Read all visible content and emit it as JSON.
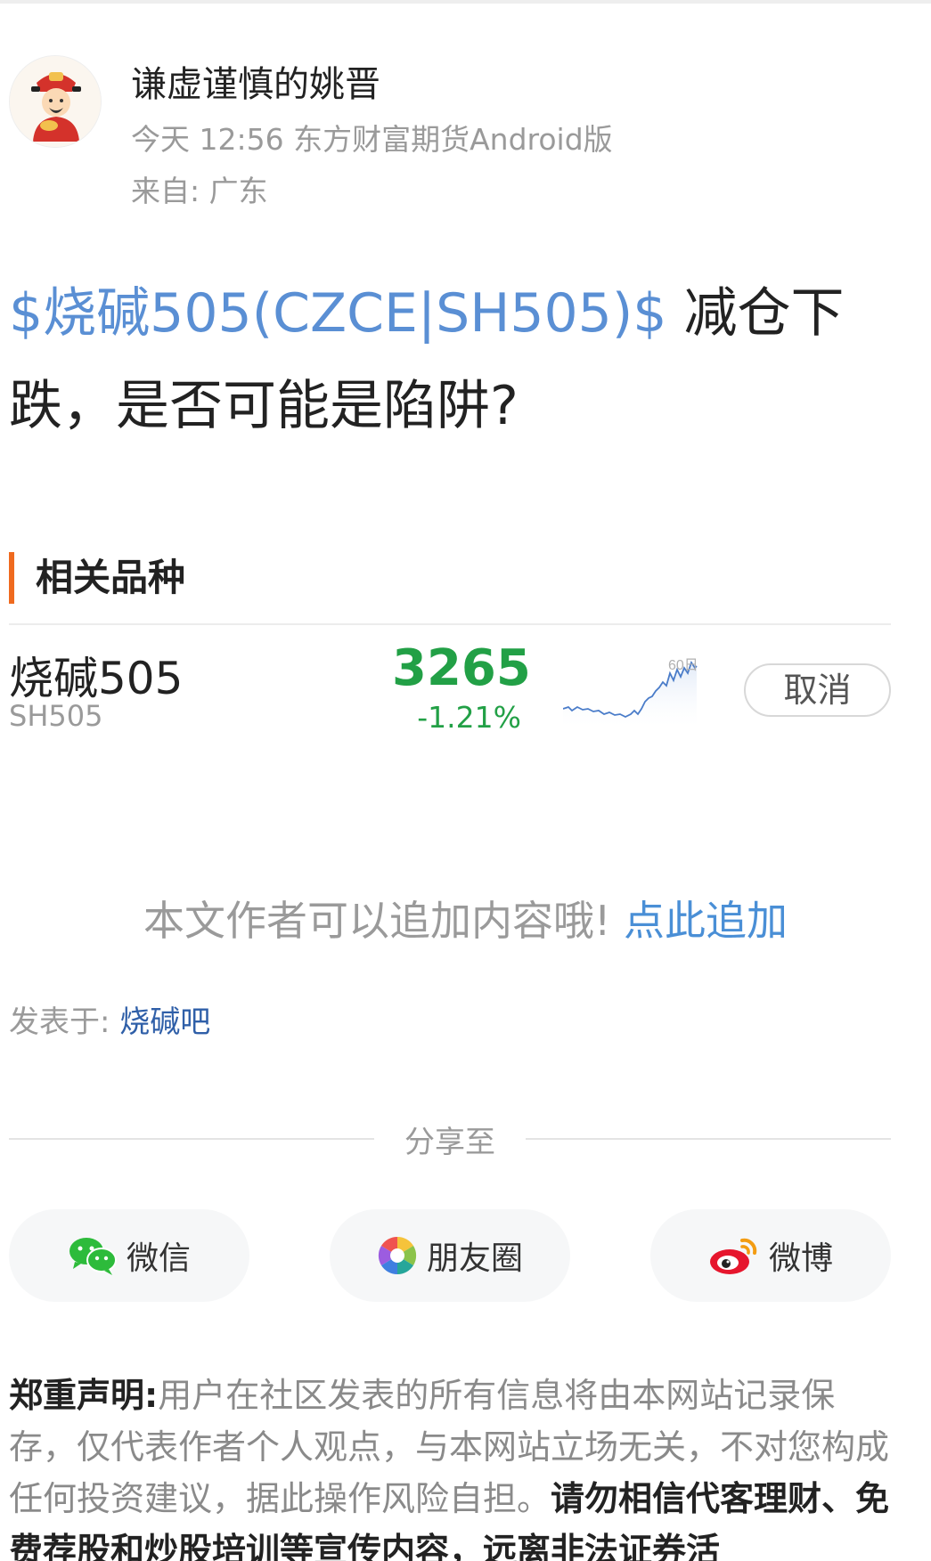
{
  "header": {
    "author": "谦虚谨慎的姚晋",
    "meta": "今天 12:56 东方财富期货Android版",
    "location": "来自: 广东",
    "avatar_icon": "god-of-wealth-avatar"
  },
  "post": {
    "stock_tag": "$烧碱505(CZCE|SH505)$",
    "title_text": " 减仓下跌，是否可能是陷阱?"
  },
  "related": {
    "section_title": "相关品种",
    "item": {
      "name": "烧碱505",
      "code": "SH505",
      "price": "3265",
      "change": "-1.21%",
      "chart_label": "60日",
      "action": "取消"
    }
  },
  "append": {
    "text": "本文作者可以追加内容哦!",
    "link": "点此追加"
  },
  "posted_in": {
    "label": "发表于: ",
    "forum": "烧碱吧"
  },
  "share": {
    "title": "分享至",
    "buttons": [
      {
        "label": "微信",
        "icon": "wechat-icon"
      },
      {
        "label": "朋友圈",
        "icon": "moments-icon"
      },
      {
        "label": "微博",
        "icon": "weibo-icon"
      }
    ]
  },
  "disclaimer": {
    "heading": "郑重声明:",
    "body": "用户在社区发表的所有信息将由本网站记录保存，仅代表作者个人观点，与本网站立场无关，不对您构成任何投资建议，据此操作风险自担。",
    "warning": "请勿相信代客理财、免费荐股和炒股培训等宣传内容，远离非法证券活"
  },
  "colors": {
    "accent_orange": "#ef6a1f",
    "stock_link_blue": "#5a8fd4",
    "down_green": "#22a046",
    "forum_blue": "#2f5fa8"
  }
}
